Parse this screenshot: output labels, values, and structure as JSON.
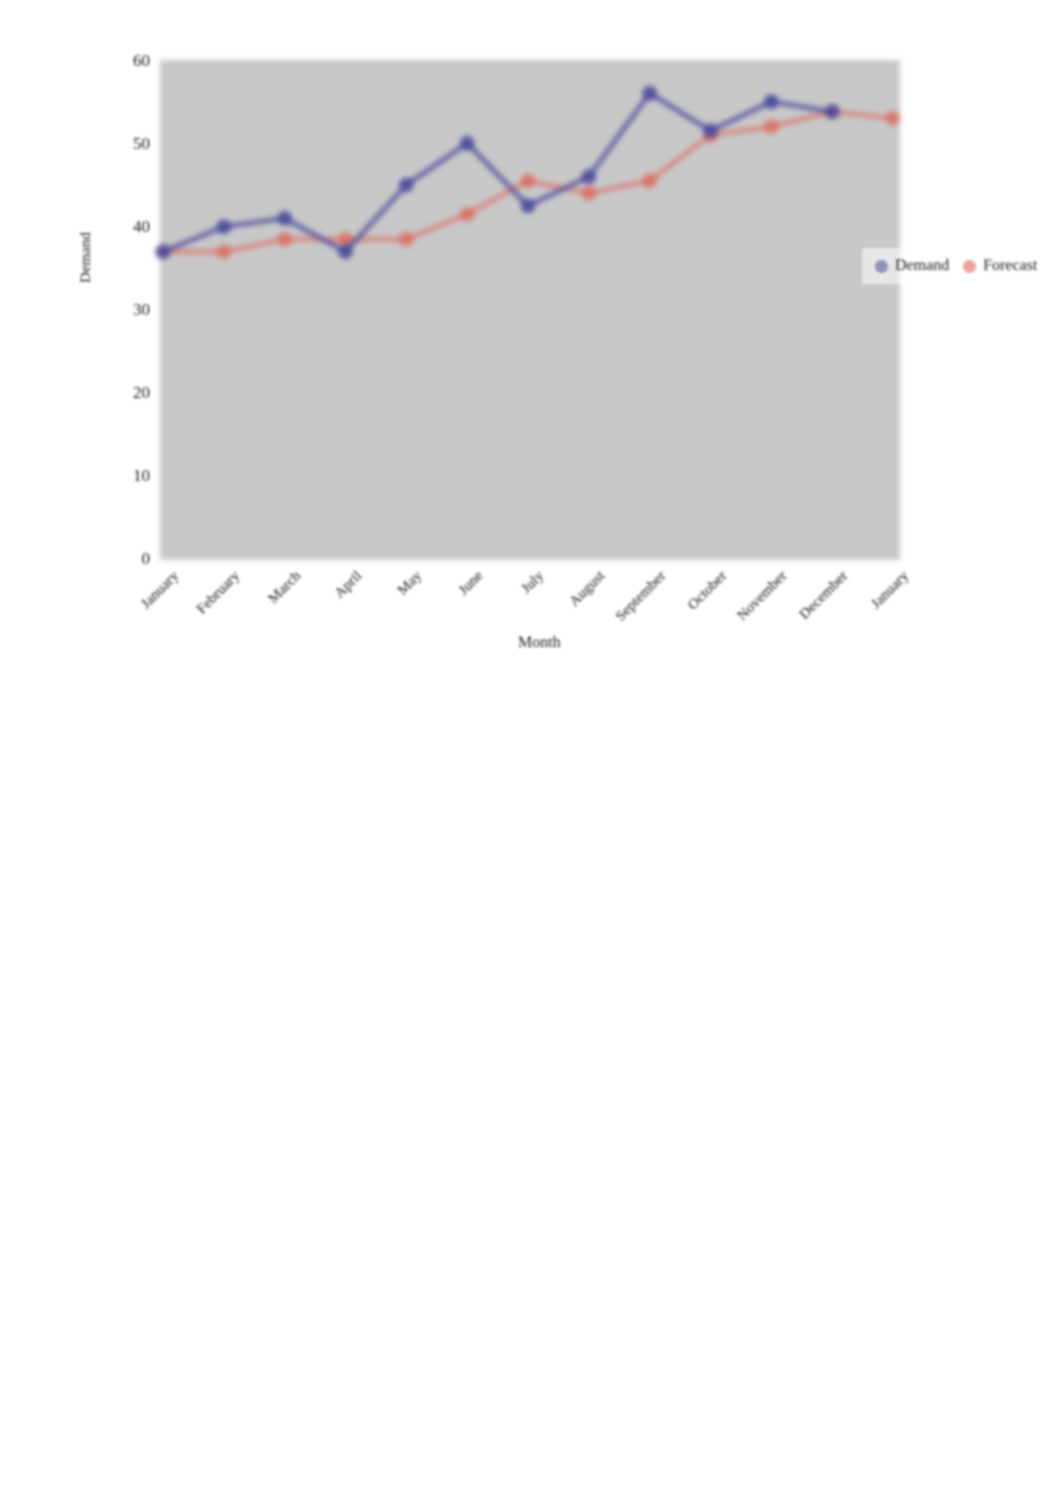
{
  "chart_data": {
    "type": "line",
    "title": "",
    "xlabel": "Month",
    "ylabel": "Demand",
    "ylim": [
      0,
      60
    ],
    "yticks": [
      0,
      10,
      20,
      30,
      40,
      50,
      60
    ],
    "grid": false,
    "legend_position": "right",
    "plot_background": "#c8c8c8",
    "categories": [
      "January",
      "February",
      "March",
      "April",
      "May",
      "June",
      "July",
      "August",
      "September",
      "October",
      "November",
      "December",
      "January"
    ],
    "series": [
      {
        "name": "Demand",
        "color": "#4a4a9c",
        "marker": "circle",
        "values": [
          37,
          40,
          41,
          37,
          45,
          50,
          42.5,
          46,
          56,
          51.5,
          55,
          53.8,
          null
        ]
      },
      {
        "name": "Forecast",
        "color": "#e05a4a",
        "marker": "circle",
        "values": [
          37,
          37,
          38.5,
          38.5,
          38.5,
          41.5,
          45.5,
          44,
          45.5,
          51,
          52,
          53.8,
          53
        ]
      }
    ]
  },
  "axes": {
    "y_title": "Demand",
    "x_title": "Month",
    "y_tick_labels": [
      "60",
      "50",
      "40",
      "30",
      "20",
      "10",
      "0"
    ]
  },
  "legend": {
    "entries": [
      {
        "label": "Demand",
        "color": "#4a4a9c"
      },
      {
        "label": "Forecast",
        "color": "#e05a4a"
      }
    ]
  }
}
